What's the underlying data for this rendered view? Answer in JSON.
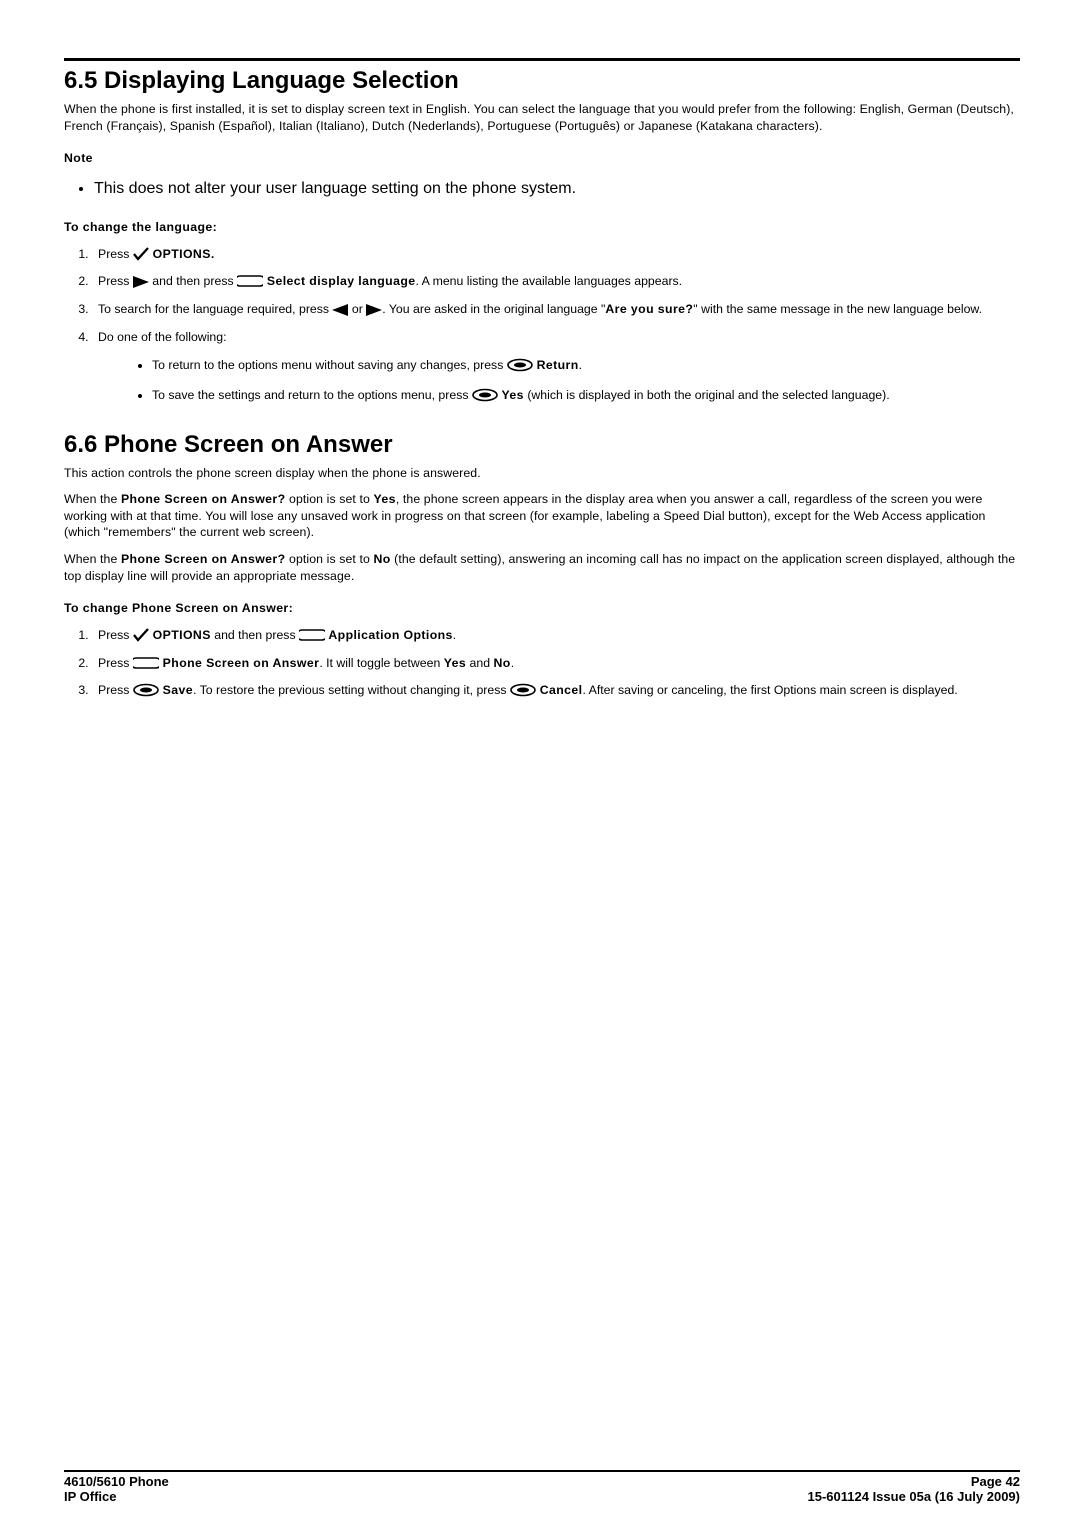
{
  "section65": {
    "heading": "6.5 Displaying Language Selection",
    "intro": "When the phone is first installed, it is set to display screen text in English. You can select the language that you would prefer from the following:  English, German (Deutsch), French (Français), Spanish (Español), Italian (Italiano), Dutch (Nederlands), Portuguese (Português) or Japanese (Katakana characters).",
    "note_label": "Note",
    "note_bullet": "This does not alter your user language setting on the phone system.",
    "change_label": "To change the language:",
    "step1_a": "Press ",
    "step1_b": " OPTIONS.",
    "step2_a": "Press ",
    "step2_b": " and then press ",
    "step2_c": " Select display language",
    "step2_d": ". A menu listing the available languages appears.",
    "step3_a": "To search for the language required, press ",
    "step3_b": " or ",
    "step3_c": "Are you sure?",
    "step3_pre": ". You are asked in the original language \"",
    "step3_post": "\" with the same message in the new language below.",
    "step4": "Do one of the following:",
    "step4_bullet1_a": "To return to the options menu without saving any changes, press ",
    "step4_bullet1_b": " Return",
    "step4_bullet1_c": ".",
    "step4_bullet2_a": "To save the settings and return to the options menu, press ",
    "step4_bullet2_b": " Yes",
    "step4_bullet2_c": " (which is displayed in both the original and the selected language)."
  },
  "section66": {
    "heading": "6.6 Phone Screen on Answer",
    "p1": "This action controls the phone screen display when the phone is answered.",
    "p2_a": "When the ",
    "p2_b": "Phone Screen on Answer?",
    "p2_c": " option is set to ",
    "p2_d": "Yes",
    "p2_e": ", the phone screen appears in the display area when you answer a call, regardless of the screen you were working with at that time. You will lose any unsaved work in progress on that screen (for example, labeling a Speed Dial button), except for the Web Access application (which \"remembers\" the current web screen).",
    "p3_a": "When the ",
    "p3_b": "Phone Screen on Answer?",
    "p3_c": " option is set to ",
    "p3_d": "No",
    "p3_e": " (the default setting), answering an incoming call has no impact on the application screen displayed, although the top display line will provide an appropriate message.",
    "change_label": "To change Phone Screen on Answer:",
    "s1_a": "Press ",
    "s1_b": " OPTIONS",
    "s1_c": " and then press ",
    "s1_d": " Application Options",
    "s1_e": ".",
    "s2_a": "Press ",
    "s2_b": " Phone Screen on Answer",
    "s2_c": ". It will toggle between ",
    "s2_d": "Yes",
    "s2_e": " and ",
    "s2_f": "No",
    "s2_g": ".",
    "s3_a": "Press ",
    "s3_b": " Save",
    "s3_c": ". To restore the previous setting without changing it, press ",
    "s3_d": " Cancel",
    "s3_e": ". After saving or canceling, the first Options main screen is displayed."
  },
  "footer": {
    "left1": "4610/5610 Phone",
    "left2": "IP Office",
    "right1": "Page 42",
    "right2": "15-601124 Issue 05a (16 July 2009)"
  }
}
